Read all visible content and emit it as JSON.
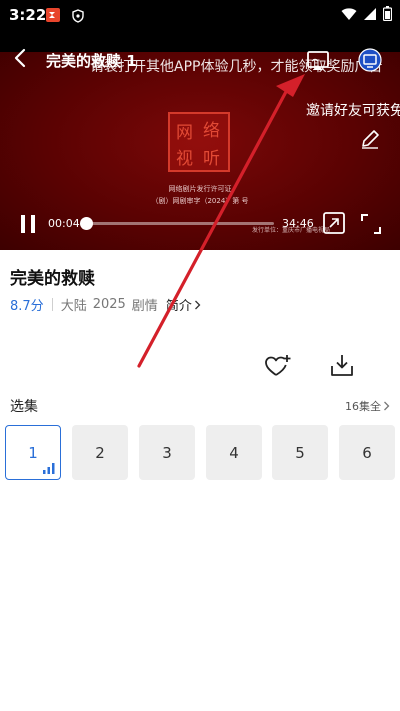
{
  "status_bar": {
    "time": "3:22",
    "icons": [
      "app-notification-icon",
      "shield-icon",
      "wifi-icon",
      "signal-icon",
      "battery-icon"
    ]
  },
  "player": {
    "title": "完美的救赎 1",
    "marquee_text": "请裂打开其他APP体验几秒，才能领取奖励广告",
    "invite_text": "邀请好友可获免",
    "current_time": "00:04",
    "total_time": "34:46",
    "progress": 0.002,
    "video_frame": {
      "seal_glyphs": [
        "网",
        "络",
        "视",
        "听"
      ],
      "caption_line1": "网络剧片发行许可证",
      "caption_line2": "（剧）网剧审字（2024）第 号",
      "corner_text": "发行单位：重庆市广播电视局"
    },
    "icons": [
      "back-icon",
      "cast-icon",
      "pip-icon",
      "pencil-icon",
      "pause-icon",
      "mini-window-icon",
      "fullscreen-icon"
    ]
  },
  "info": {
    "title": "完美的救赎",
    "score": "8.7分",
    "region": "大陆",
    "year": "2025",
    "genre": "剧情",
    "intro_link": "简介"
  },
  "actions": {
    "icons": [
      "favorite-add-icon",
      "download-icon"
    ]
  },
  "episodes": {
    "label": "选集",
    "count_text": "16集全",
    "items": [
      "1",
      "2",
      "3",
      "4",
      "5",
      "6"
    ],
    "selected_index": 0
  },
  "colors": {
    "accent": "#2a6fd8",
    "annotation_arrow": "#d4202a",
    "video_background": "#5a0202"
  }
}
